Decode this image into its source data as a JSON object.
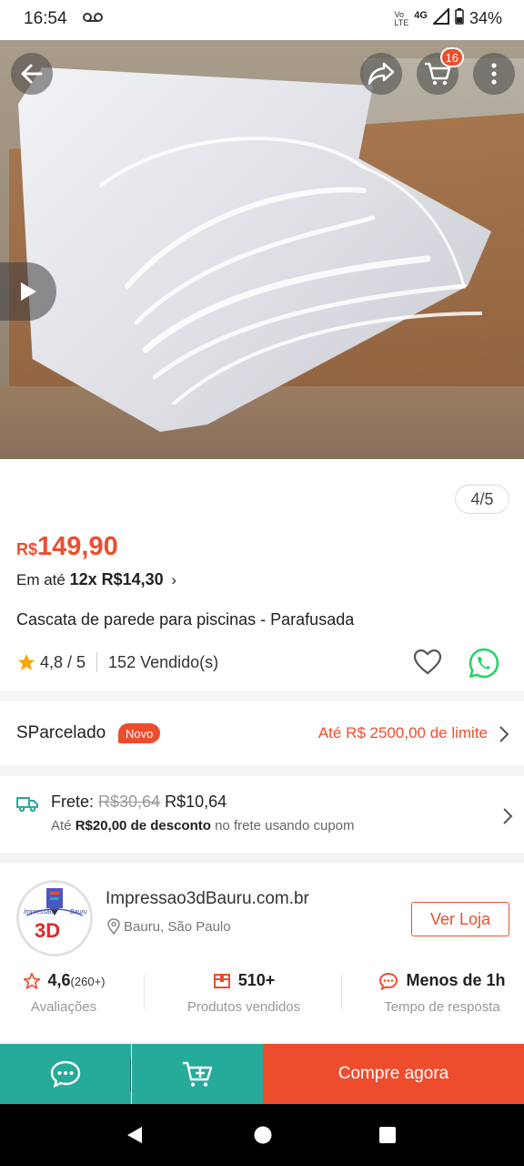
{
  "status_bar": {
    "time": "16:54",
    "network_top": "Vo",
    "network_bottom": "LTE",
    "network_type": "4G",
    "battery": "34%"
  },
  "header": {
    "cart_count": "16"
  },
  "gallery": {
    "counter": "4/5"
  },
  "product": {
    "currency": "R$",
    "price": "149,90",
    "installment_prefix": "Em até ",
    "installment_value": "12x R$14,30",
    "installment_chevron": "›",
    "title": "Cascata de parede para piscinas - Parafusada",
    "rating": "4,8 / 5",
    "sold": "152 Vendido(s)"
  },
  "sparcelado": {
    "label": "SParcelado",
    "badge": "Novo",
    "limit": "Até R$ 2500,00 de limite"
  },
  "shipping": {
    "label": "Frete: ",
    "old_price": "R$30,64",
    "new_price": " R$10,64",
    "discount_prefix": "Até ",
    "discount_value": "R$20,00 de desconto",
    "discount_suffix": " no frete usando cupom"
  },
  "store": {
    "name": "Impressao3dBauru.com.br",
    "location": "Bauru, São Paulo",
    "visit_button": "Ver Loja",
    "logo_text_top": "Impressão",
    "logo_text_right": "Bauru",
    "logo_text_main": "3D",
    "stats": [
      {
        "value": "4,6",
        "extra": "(260+)",
        "label": "Avaliações"
      },
      {
        "value": "510+",
        "label": "Produtos vendidos"
      },
      {
        "value": "Menos de 1h",
        "label": "Tempo de resposta"
      }
    ]
  },
  "actions": {
    "buy_now": "Compre agora"
  },
  "colors": {
    "accent": "#ee4d2d",
    "teal": "#26aa99",
    "star": "#f6a700",
    "whatsapp": "#25d366"
  }
}
